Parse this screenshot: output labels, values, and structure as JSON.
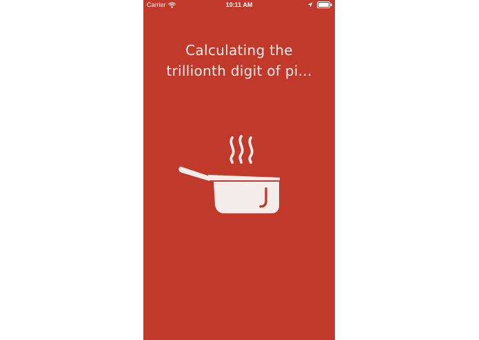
{
  "status_bar": {
    "carrier": "Carrier",
    "time": "10:11 AM",
    "icons": [
      "wifi-icon",
      "location-arrow-icon",
      "battery-icon"
    ]
  },
  "loading_screen": {
    "message_line1": "Calculating the",
    "message_line2": "trillionth digit of pi...",
    "illustration": "steaming-pot-icon"
  },
  "colors": {
    "background": "#c0392b",
    "foreground": "#f4ecea",
    "page_margin": "#ffffff"
  }
}
